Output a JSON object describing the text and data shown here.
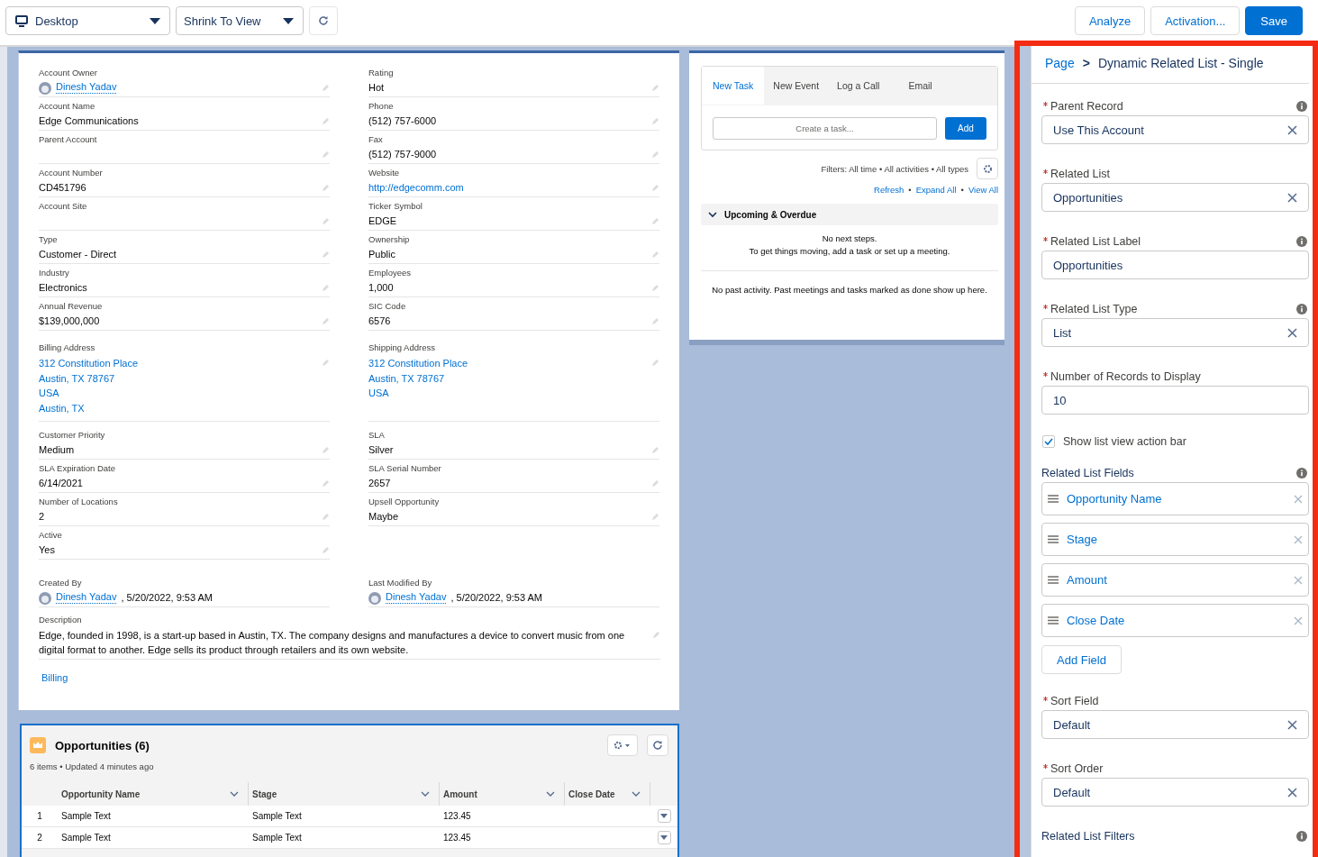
{
  "toolbar": {
    "device": "Desktop",
    "zoom": "Shrink To View",
    "actions": [
      {
        "label": "Analyze",
        "primary": false
      },
      {
        "label": "Activation...",
        "primary": false
      },
      {
        "label": "Save",
        "primary": true
      }
    ]
  },
  "record": {
    "rows": [
      [
        {
          "label": "Account Owner",
          "kind": "user",
          "value": "Dinesh Yadav"
        },
        {
          "label": "Rating",
          "kind": "text",
          "value": "Hot"
        }
      ],
      [
        {
          "label": "Account Name",
          "kind": "text",
          "value": "Edge Communications"
        },
        {
          "label": "Phone",
          "kind": "text",
          "value": "(512) 757-6000"
        }
      ],
      [
        {
          "label": "Parent Account",
          "kind": "empty"
        },
        {
          "label": "Fax",
          "kind": "text",
          "value": "(512) 757-9000"
        }
      ],
      [
        {
          "label": "Account Number",
          "kind": "text",
          "value": "CD451796"
        },
        {
          "label": "Website",
          "kind": "link",
          "value": "http://edgecomm.com"
        }
      ],
      [
        {
          "label": "Account Site",
          "kind": "empty"
        },
        {
          "label": "Ticker Symbol",
          "kind": "text",
          "value": "EDGE"
        }
      ],
      [
        {
          "label": "Type",
          "kind": "text",
          "value": "Customer - Direct"
        },
        {
          "label": "Ownership",
          "kind": "text",
          "value": "Public"
        }
      ],
      [
        {
          "label": "Industry",
          "kind": "text",
          "value": "Electronics"
        },
        {
          "label": "Employees",
          "kind": "text",
          "value": "1,000"
        }
      ],
      [
        {
          "label": "Annual Revenue",
          "kind": "text",
          "value": "$139,000,000"
        },
        {
          "label": "SIC Code",
          "kind": "text",
          "value": "6576"
        }
      ],
      [
        {
          "label": "Billing Address",
          "kind": "address",
          "lines": [
            "312 Constitution Place",
            "Austin, TX 78767",
            "USA",
            "Austin, TX"
          ]
        },
        {
          "label": "Shipping Address",
          "kind": "address",
          "lines": [
            "312 Constitution Place",
            "Austin, TX 78767",
            "USA"
          ]
        }
      ],
      [
        {
          "label": "Customer Priority",
          "kind": "text",
          "value": "Medium"
        },
        {
          "label": "SLA",
          "kind": "text",
          "value": "Silver"
        }
      ],
      [
        {
          "label": "SLA Expiration Date",
          "kind": "text",
          "value": "6/14/2021"
        },
        {
          "label": "SLA Serial Number",
          "kind": "text",
          "value": "2657"
        }
      ],
      [
        {
          "label": "Number of Locations",
          "kind": "text",
          "value": "2"
        },
        {
          "label": "Upsell Opportunity",
          "kind": "text",
          "value": "Maybe"
        }
      ],
      [
        {
          "label": "Active",
          "kind": "text",
          "value": "Yes"
        }
      ],
      [
        {
          "label": "Created By",
          "kind": "user",
          "value": "Dinesh Yadav",
          "suffix": ", 5/20/2022, 9:53 AM",
          "editable": false
        },
        {
          "label": "Last Modified By",
          "kind": "user",
          "value": "Dinesh Yadav",
          "suffix": ", 5/20/2022, 9:53 AM",
          "editable": false
        }
      ]
    ],
    "description": {
      "label": "Description",
      "value": "Edge, founded in 1998, is a start-up based in Austin, TX. The company designs and manufactures a device to convert music from one digital format to another. Edge sells its product through retailers and its own website."
    },
    "link": "Billing"
  },
  "activity": {
    "tabs": [
      {
        "label": "New Task",
        "selected": true
      },
      {
        "label": "New Event",
        "selected": false
      },
      {
        "label": "Log a Call",
        "selected": false
      },
      {
        "label": "Email",
        "selected": false
      }
    ],
    "task_placeholder": "Create a task...",
    "add_button": "Add",
    "filters": "Filters: All time • All activities • All types",
    "links": [
      "Refresh",
      "Expand All",
      "View All"
    ],
    "separator": "•",
    "section": {
      "title": "Upcoming & Overdue",
      "expanded": true,
      "messages": [
        "No next steps.",
        "To get things moving, add a task or set up a meeting."
      ]
    },
    "past": "No past activity. Past meetings and tasks marked as done show up here."
  },
  "related": {
    "title": "Opportunities (6)",
    "subtitle": "6 items • Updated 4 minutes ago",
    "columns": [
      "Opportunity Name",
      "Stage",
      "Amount",
      "Close Date"
    ],
    "rows": [
      {
        "number": "1",
        "name": "Sample Text",
        "stage": "Sample Text",
        "amount": "123.45"
      },
      {
        "number": "2",
        "name": "Sample Text",
        "stage": "Sample Text",
        "amount": "123.45"
      }
    ]
  },
  "panel": {
    "breadcrumb": {
      "link": "Page",
      "separator": ">",
      "current": "Dynamic Related List - Single"
    },
    "properties": [
      {
        "kind": "select",
        "label": "Parent Record",
        "required": true,
        "info": true,
        "value": "Use This Account"
      },
      {
        "kind": "select",
        "label": "Related List",
        "required": true,
        "info": false,
        "value": "Opportunities"
      },
      {
        "kind": "input",
        "label": "Related List Label",
        "required": true,
        "info": true,
        "value": "Opportunities"
      },
      {
        "kind": "select",
        "label": "Related List Type",
        "required": true,
        "info": true,
        "value": "List"
      },
      {
        "kind": "input",
        "label": "Number of Records to Display",
        "required": true,
        "info": false,
        "value": "10"
      },
      {
        "kind": "checkbox",
        "label": "Show list view action bar",
        "checked": true
      },
      {
        "kind": "fields",
        "label": "Related List Fields",
        "info": true,
        "items": [
          "Opportunity Name",
          "Stage",
          "Amount",
          "Close Date"
        ],
        "add_label": "Add Field"
      },
      {
        "kind": "select",
        "label": "Sort Field",
        "required": true,
        "info": false,
        "value": "Default"
      },
      {
        "kind": "select",
        "label": "Sort Order",
        "required": true,
        "info": false,
        "value": "Default"
      },
      {
        "kind": "heading",
        "label": "Related List Filters",
        "info": true
      }
    ]
  }
}
